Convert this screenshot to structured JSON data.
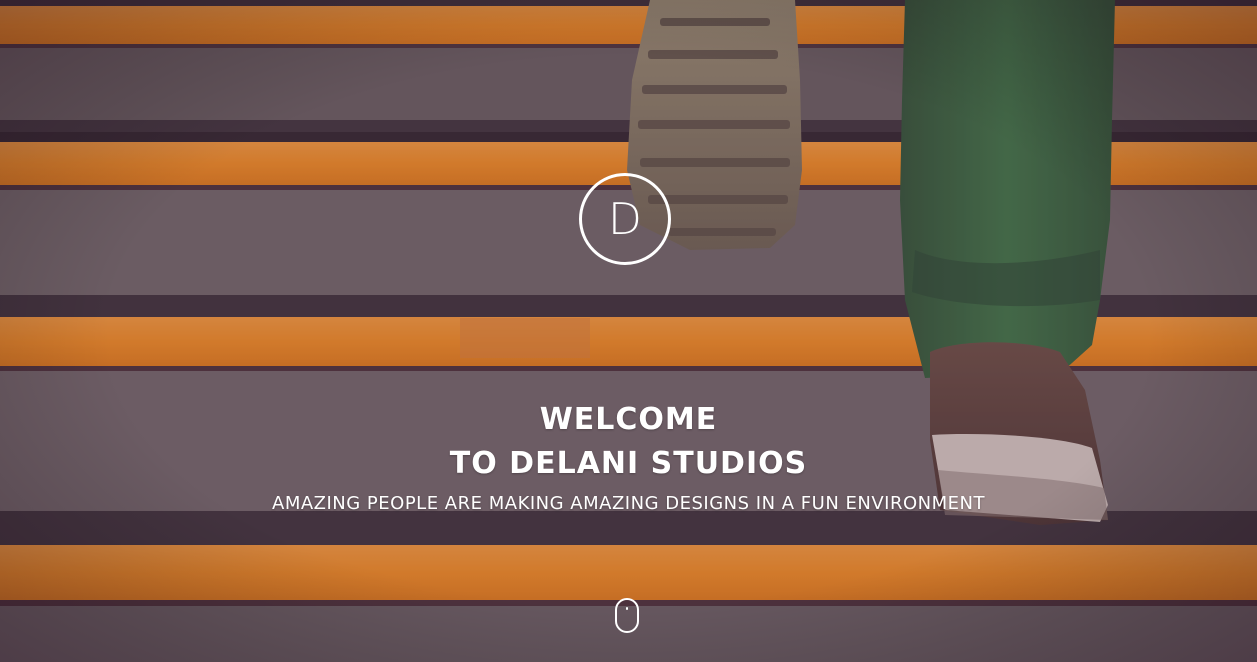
{
  "hero": {
    "logo_letter": "D",
    "headline_line1": "WELCOME",
    "headline_line2": "TO DELANI STUDIOS",
    "tagline": "AMAZING PEOPLE ARE MAKING AMAZING DESIGNS IN A FUN ENVIRONMENT",
    "scroll_indicator_icon": "mouse-scroll-icon",
    "background_image": "orange-striped-stairs-person-climbing"
  },
  "colors": {
    "stair_orange": "#f3921c",
    "concrete_gray": "#6f6d69",
    "overlay_purple": "#3a0f33",
    "text": "#ffffff"
  }
}
